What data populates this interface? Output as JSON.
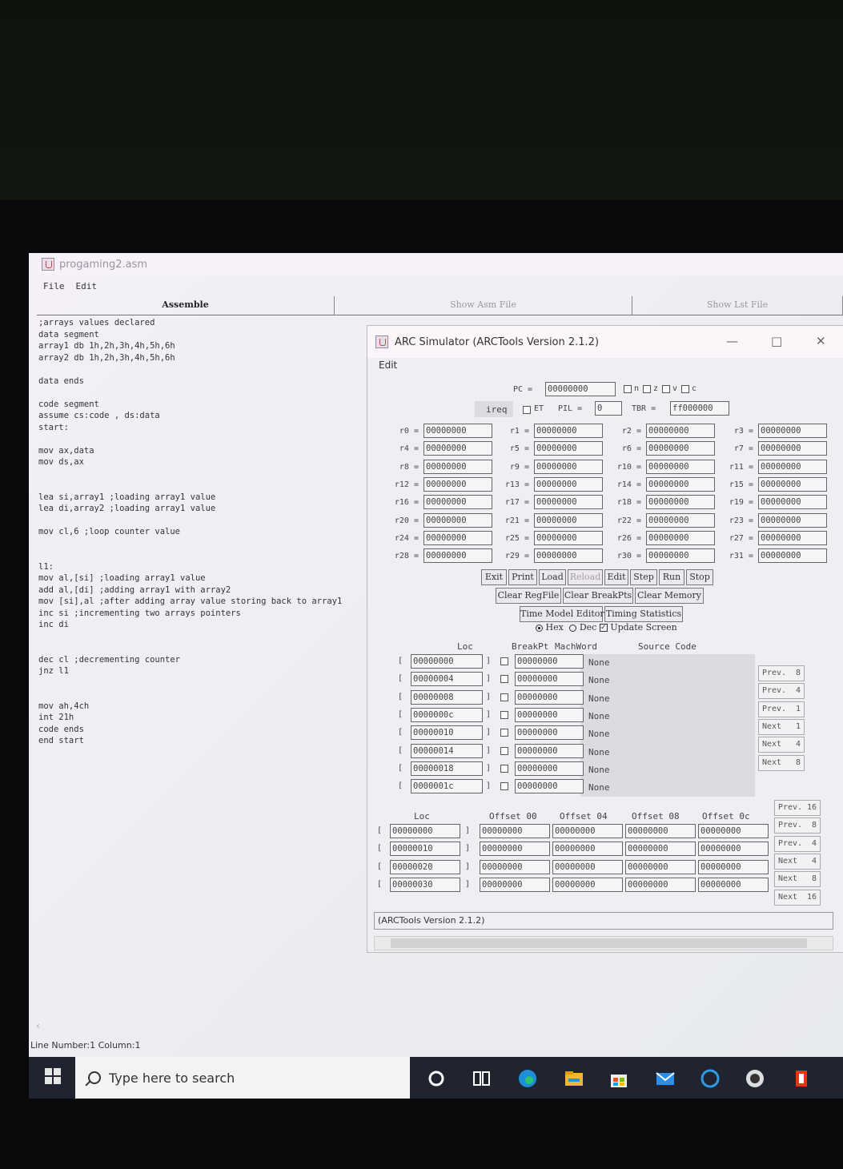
{
  "editor": {
    "title": "progaming2.asm",
    "menu": [
      "File",
      "Edit"
    ],
    "tabs": [
      "Assemble",
      "Show Asm File",
      "Show Lst File"
    ],
    "code_lines": [
      ";arrays values declared",
      "data segment",
      "array1 db 1h,2h,3h,4h,5h,6h",
      "array2 db 1h,2h,3h,4h,5h,6h",
      "",
      "data ends",
      "",
      "code segment",
      "assume cs:code , ds:data",
      "start:",
      "",
      "mov ax,data",
      "mov ds,ax",
      "",
      "",
      "lea si,array1 ;loading array1 value",
      "lea di,array2 ;loading array1 value",
      "",
      "mov cl,6 ;loop counter value",
      "",
      "",
      "l1:",
      "mov al,[si] ;loading array1 value",
      "add al,[di] ;adding array1 with array2",
      "mov [si],al ;after adding array value storing back to array1",
      "inc si ;incrementing two arrays pointers",
      "inc di",
      "",
      "",
      "dec cl ;decrementing counter",
      "jnz l1",
      "",
      "",
      "mov ah,4ch",
      "int 21h",
      "code ends",
      "end start"
    ],
    "status": "Line Number:1 Column:1"
  },
  "arc": {
    "title": "ARC Simulator (ARCTools Version 2.1.2)",
    "menu": "Edit",
    "pc_label": "PC =",
    "pc_value": "00000000",
    "flags": [
      "n",
      "z",
      "v",
      "c"
    ],
    "ireq_label": "ireq",
    "et_label": "ET",
    "pil_label": "PIL =",
    "pil_value": "0",
    "tbr_label": "TBR =",
    "tbr_value": "ff000000",
    "registers": [
      [
        "r0",
        "r1",
        "r2",
        "r3"
      ],
      [
        "r4",
        "r5",
        "r6",
        "r7"
      ],
      [
        "r8",
        "r9",
        "r10",
        "r11"
      ],
      [
        "r12",
        "r13",
        "r14",
        "r15"
      ],
      [
        "r16",
        "r17",
        "r18",
        "r19"
      ],
      [
        "r20",
        "r21",
        "r22",
        "r23"
      ],
      [
        "r24",
        "r25",
        "r26",
        "r27"
      ],
      [
        "r28",
        "r29",
        "r30",
        "r31"
      ]
    ],
    "reg_value": "00000000",
    "buttons_row1": [
      "Exit",
      "Print",
      "Load",
      "Reload",
      "Edit",
      "Step",
      "Run",
      "Stop"
    ],
    "buttons_row2": [
      "Clear RegFile",
      "Clear BreakPts",
      "Clear Memory"
    ],
    "buttons_row3": [
      "Time Model Editor",
      "Timing Statistics"
    ],
    "hex_label": "Hex",
    "dec_label": "Dec",
    "update_label": "Update Screen",
    "prog_headers": {
      "loc": "Loc",
      "bp": "BreakPt",
      "mw": "MachWord",
      "src": "Source Code"
    },
    "prog_rows": [
      {
        "loc": "00000000",
        "word": "00000000",
        "src": "None"
      },
      {
        "loc": "00000004",
        "word": "00000000",
        "src": "None"
      },
      {
        "loc": "00000008",
        "word": "00000000",
        "src": "None"
      },
      {
        "loc": "0000000c",
        "word": "00000000",
        "src": "None"
      },
      {
        "loc": "00000010",
        "word": "00000000",
        "src": "None"
      },
      {
        "loc": "00000014",
        "word": "00000000",
        "src": "None"
      },
      {
        "loc": "00000018",
        "word": "00000000",
        "src": "None"
      },
      {
        "loc": "0000001c",
        "word": "00000000",
        "src": "None"
      }
    ],
    "prog_nav": [
      {
        "l": "Prev.",
        "n": "8"
      },
      {
        "l": "Prev.",
        "n": "4"
      },
      {
        "l": "Prev.",
        "n": "1"
      },
      {
        "l": "Next",
        "n": "1"
      },
      {
        "l": "Next",
        "n": "4"
      },
      {
        "l": "Next",
        "n": "8"
      }
    ],
    "mem_headers": [
      "Loc",
      "Offset 00",
      "Offset 04",
      "Offset 08",
      "Offset 0c"
    ],
    "mem_rows": [
      {
        "loc": "00000000",
        "v": [
          "00000000",
          "00000000",
          "00000000",
          "00000000"
        ]
      },
      {
        "loc": "00000010",
        "v": [
          "00000000",
          "00000000",
          "00000000",
          "00000000"
        ]
      },
      {
        "loc": "00000020",
        "v": [
          "00000000",
          "00000000",
          "00000000",
          "00000000"
        ]
      },
      {
        "loc": "00000030",
        "v": [
          "00000000",
          "00000000",
          "00000000",
          "00000000"
        ]
      }
    ],
    "mem_nav": [
      {
        "l": "Prev.",
        "n": "16"
      },
      {
        "l": "Prev.",
        "n": "8"
      },
      {
        "l": "Prev.",
        "n": "4"
      },
      {
        "l": "Next",
        "n": "4"
      },
      {
        "l": "Next",
        "n": "8"
      },
      {
        "l": "Next",
        "n": "16"
      }
    ],
    "status": "(ARCTools Version 2.1.2)"
  },
  "taskbar": {
    "search_placeholder": "Type here to search"
  }
}
